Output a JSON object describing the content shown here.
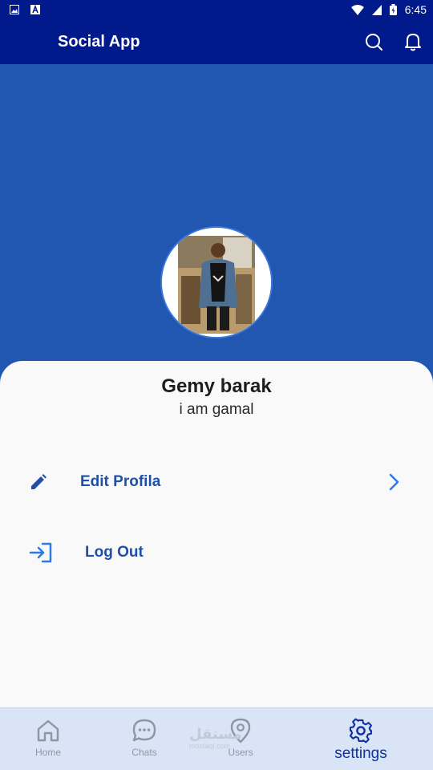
{
  "status_bar": {
    "time": "6:45"
  },
  "app_bar": {
    "title": "Social App"
  },
  "profile": {
    "name": "Gemy barak",
    "bio": "i am gamal"
  },
  "menu": {
    "edit_label": "Edit Profila",
    "logout_label": "Log Out"
  },
  "bottom_nav": {
    "home": "Home",
    "chats": "Chats",
    "users": "Users",
    "settings": "settings"
  },
  "watermark": {
    "logo_text": "مستقل",
    "url": "mostaql.com"
  },
  "colors": {
    "app_bar": "#001a8c",
    "cover": "#2157b1",
    "accent": "#1f4fa6",
    "nav_bg": "#d9e5f7",
    "nav_active": "#11319c",
    "nav_inactive": "#8e96a3"
  }
}
